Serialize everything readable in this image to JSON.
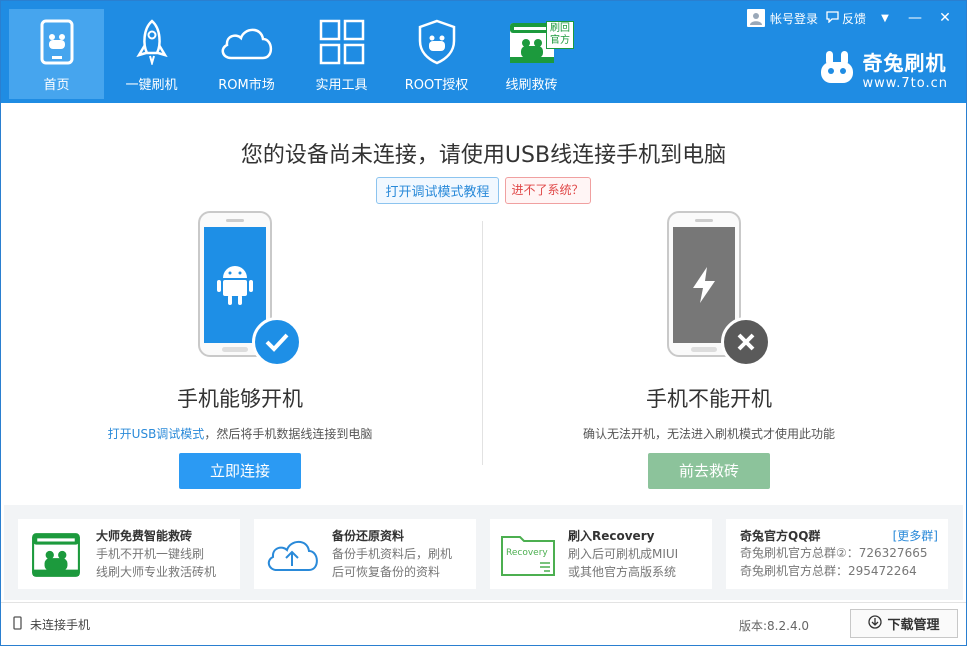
{
  "nav": {
    "items": [
      {
        "label": "首页",
        "icon": "home-phone-icon"
      },
      {
        "label": "一键刷机",
        "icon": "rocket-icon"
      },
      {
        "label": "ROM市场",
        "icon": "cloud-icon"
      },
      {
        "label": "实用工具",
        "icon": "grid-icon"
      },
      {
        "label": "ROOT授权",
        "icon": "shield-icon"
      },
      {
        "label": "线刷救砖",
        "icon": "rescue-icon"
      }
    ],
    "badge": "刷回官方",
    "active": "首页"
  },
  "window": {
    "login": "帐号登录",
    "feedback": "反馈",
    "menu_glyph": "▼",
    "minimize_glyph": "—",
    "close_glyph": "✕"
  },
  "brand": {
    "name": "奇兔刷机",
    "url": "www.7to.cn"
  },
  "main": {
    "headline": "您的设备尚未连接，请使用USB线连接手机到电脑",
    "link_tutorial": "打开调试模式教程",
    "link_no_system": "进不了系统？",
    "left": {
      "title": "手机能够开机",
      "desc_highlight": "打开USB调试模式",
      "desc_rest": "，然后将手机数据线连接到电脑",
      "button": "立即连接"
    },
    "right": {
      "title": "手机不能开机",
      "desc": "确认无法开机，无法进入刷机模式才使用此功能",
      "button": "前去救砖"
    }
  },
  "cards": [
    {
      "title": "大师免费智能救砖",
      "line1": "手机不开机一键线刷",
      "line2": "线刷大师专业救活砖机"
    },
    {
      "title": "备份还原资料",
      "line1": "备份手机资料后，刷机",
      "line2": "后可恢复备份的资料"
    },
    {
      "title": "刷入Recovery",
      "line1": "刷入后可刷机成MIUI",
      "line2": "或其他官方高版系统",
      "icon_text": "Recovery"
    },
    {
      "title": "奇兔官方QQ群",
      "more": "[更多群]",
      "line1": "奇兔刷机官方总群②：726327665",
      "line2": "奇兔刷机官方总群：295472264"
    }
  ],
  "statusbar": {
    "device": "未连接手机",
    "version": "版本:8.2.4.0",
    "download": "下载管理"
  },
  "colors": {
    "topbar": "#1f8ce3",
    "connect_button": "#2b9af3",
    "rescue_button": "#8cc39b",
    "check_circle": "#1e8fe6",
    "x_circle": "#5a5a5a"
  }
}
